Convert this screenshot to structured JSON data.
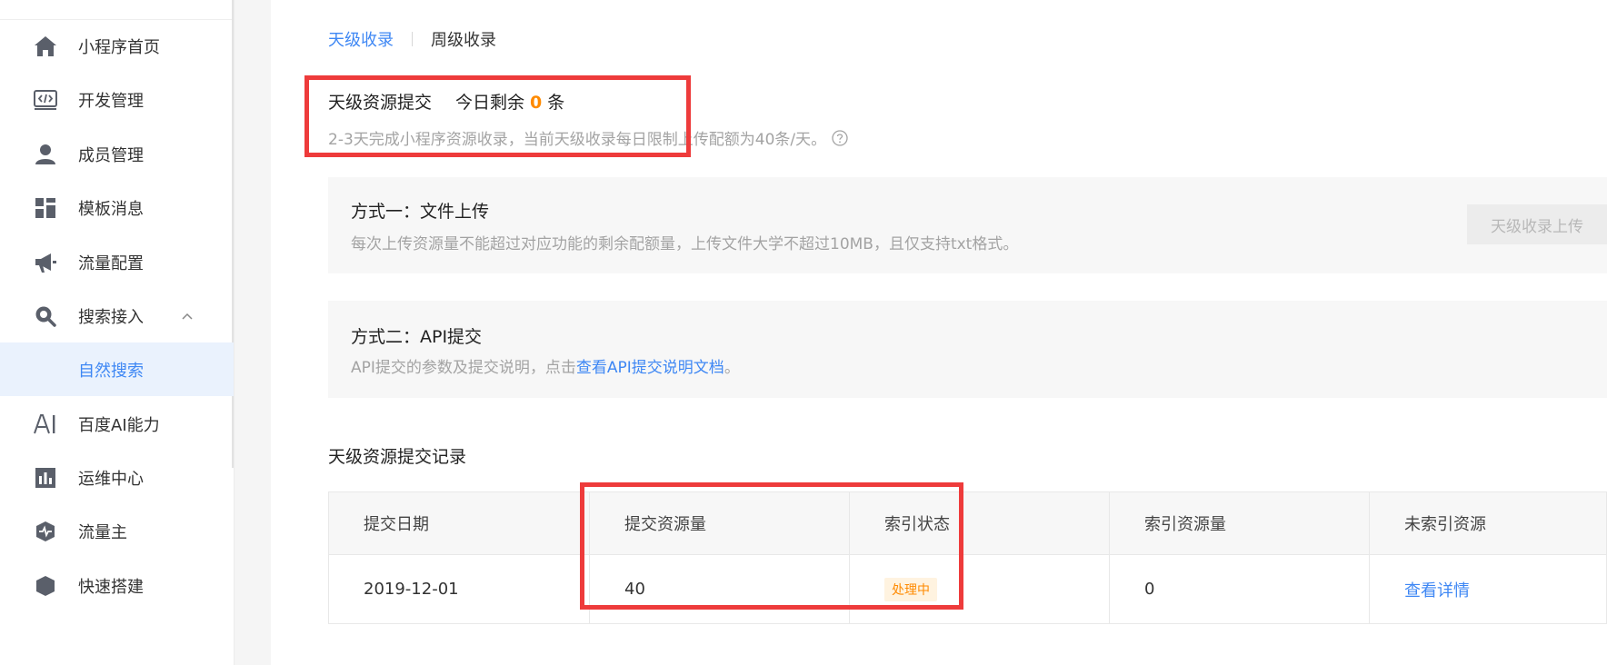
{
  "sidebar": {
    "items": [
      {
        "label": "小程序首页",
        "icon": "home-icon"
      },
      {
        "label": "开发管理",
        "icon": "code-icon"
      },
      {
        "label": "成员管理",
        "icon": "user-icon"
      },
      {
        "label": "模板消息",
        "icon": "template-icon"
      },
      {
        "label": "流量配置",
        "icon": "megaphone-icon"
      },
      {
        "label": "搜索接入",
        "icon": "search-icon",
        "expanded": true
      },
      {
        "label": "自然搜索",
        "sub": true,
        "active": true
      },
      {
        "label": "百度AI能力",
        "icon": "ai-icon"
      },
      {
        "label": "运维中心",
        "icon": "chart-icon"
      },
      {
        "label": "流量主",
        "icon": "shield-pulse-icon"
      },
      {
        "label": "快速搭建",
        "icon": "box-icon"
      }
    ]
  },
  "tabs": [
    {
      "label": "天级收录",
      "active": true
    },
    {
      "label": "周级收录",
      "active": false
    }
  ],
  "quota": {
    "title": "天级资源提交",
    "remaining_prefix": "今日剩余",
    "remaining_count": "0",
    "remaining_suffix": "条",
    "description": "2-3天完成小程序资源收录，当前天级收录每日限制上传配额为40条/天。"
  },
  "method_one": {
    "title": "方式一：文件上传",
    "description": "每次上传资源量不能超过对应功能的剩余配额量，上传文件大学不超过10MB，且仅支持txt格式。",
    "button_label": "天级收录上传"
  },
  "method_two": {
    "title": "方式二：API提交",
    "description_prefix": "API提交的参数及提交说明，点击",
    "link_label": "查看API提交说明文档",
    "description_suffix": "。"
  },
  "records": {
    "title": "天级资源提交记录",
    "columns": [
      "提交日期",
      "提交资源量",
      "索引状态",
      "索引资源量",
      "未索引资源"
    ],
    "rows": [
      {
        "date": "2019-12-01",
        "submitted": "40",
        "status": "处理中",
        "indexed": "0",
        "unindexed_link": "查看详情"
      }
    ]
  },
  "colors": {
    "accent": "#3e87f4",
    "warning": "#ff8a00",
    "highlight": "#ee3b3b"
  }
}
